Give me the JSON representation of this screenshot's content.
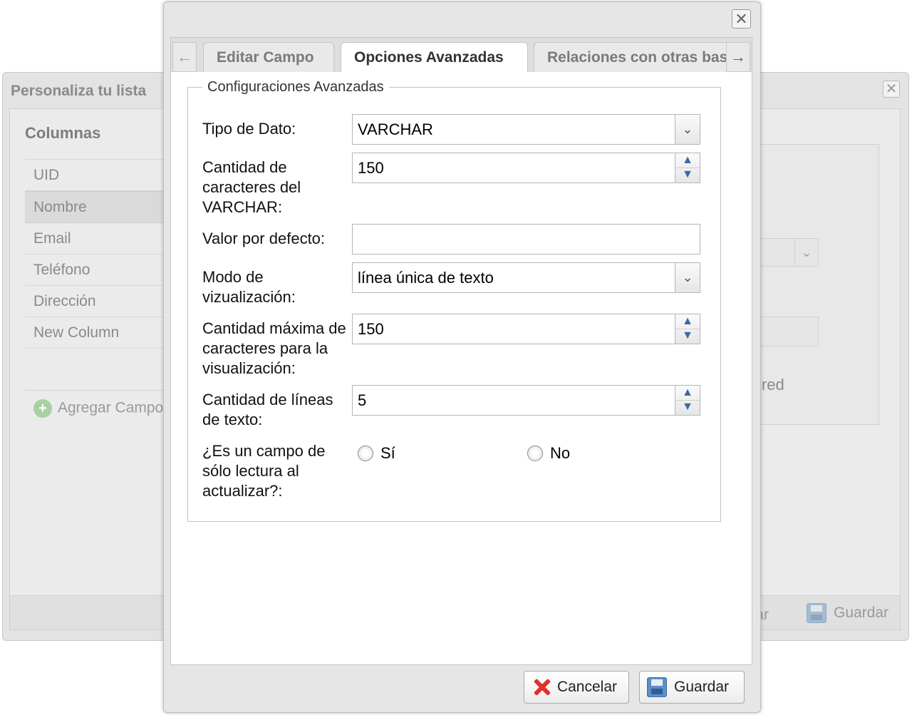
{
  "background_window": {
    "title": "Personaliza tu lista",
    "close_glyph": "✕",
    "columns_title": "Columnas",
    "columns": [
      "UID",
      "Nombre",
      "Email",
      "Teléfono",
      "Dirección",
      "New Column"
    ],
    "selected_column": "Nombre",
    "add_field_label": "Agregar Campo",
    "required_partial": "ired",
    "cancel_partial": "elar",
    "save_label": "Guardar"
  },
  "dialog": {
    "close_glyph": "✕",
    "tabs": [
      {
        "label": "Editar Campo",
        "active": false
      },
      {
        "label": "Opciones Avanzadas",
        "active": true
      },
      {
        "label": "Relaciones con otras bases",
        "active": false
      }
    ],
    "scroll_left_glyph": "←",
    "scroll_right_glyph": "→",
    "fieldset_legend": "Configuraciones Avanzadas",
    "fields": {
      "tipo_dato": {
        "label": "Tipo de Dato:",
        "value": "VARCHAR"
      },
      "cantidad_caracteres": {
        "label": "Cantidad de caracteres del VARCHAR:",
        "value": "150"
      },
      "valor_defecto": {
        "label": "Valor por defecto:",
        "value": ""
      },
      "modo_visualizacion": {
        "label": "Modo de vizualización:",
        "value": "línea única de texto"
      },
      "cantidad_maxima": {
        "label": "Cantidad máxima de caracteres para la visualización:",
        "value": "150"
      },
      "cantidad_lineas": {
        "label": "Cantidad de líneas de texto:",
        "value": "5"
      },
      "solo_lectura": {
        "label": "¿Es un campo de sólo lectura al actualizar?:",
        "option_yes": "Sí",
        "option_no": "No"
      }
    },
    "buttons": {
      "cancel": "Cancelar",
      "save": "Guardar"
    }
  },
  "icons": {
    "dropdown": "chevron-down-icon",
    "spinner_up": "▲",
    "spinner_down": "▼",
    "chevron": "⌄"
  },
  "colors": {
    "cancel_icon": "#e0312b",
    "save_icon": "#5a8fc9",
    "spinner_arrow": "#3a67a8"
  }
}
